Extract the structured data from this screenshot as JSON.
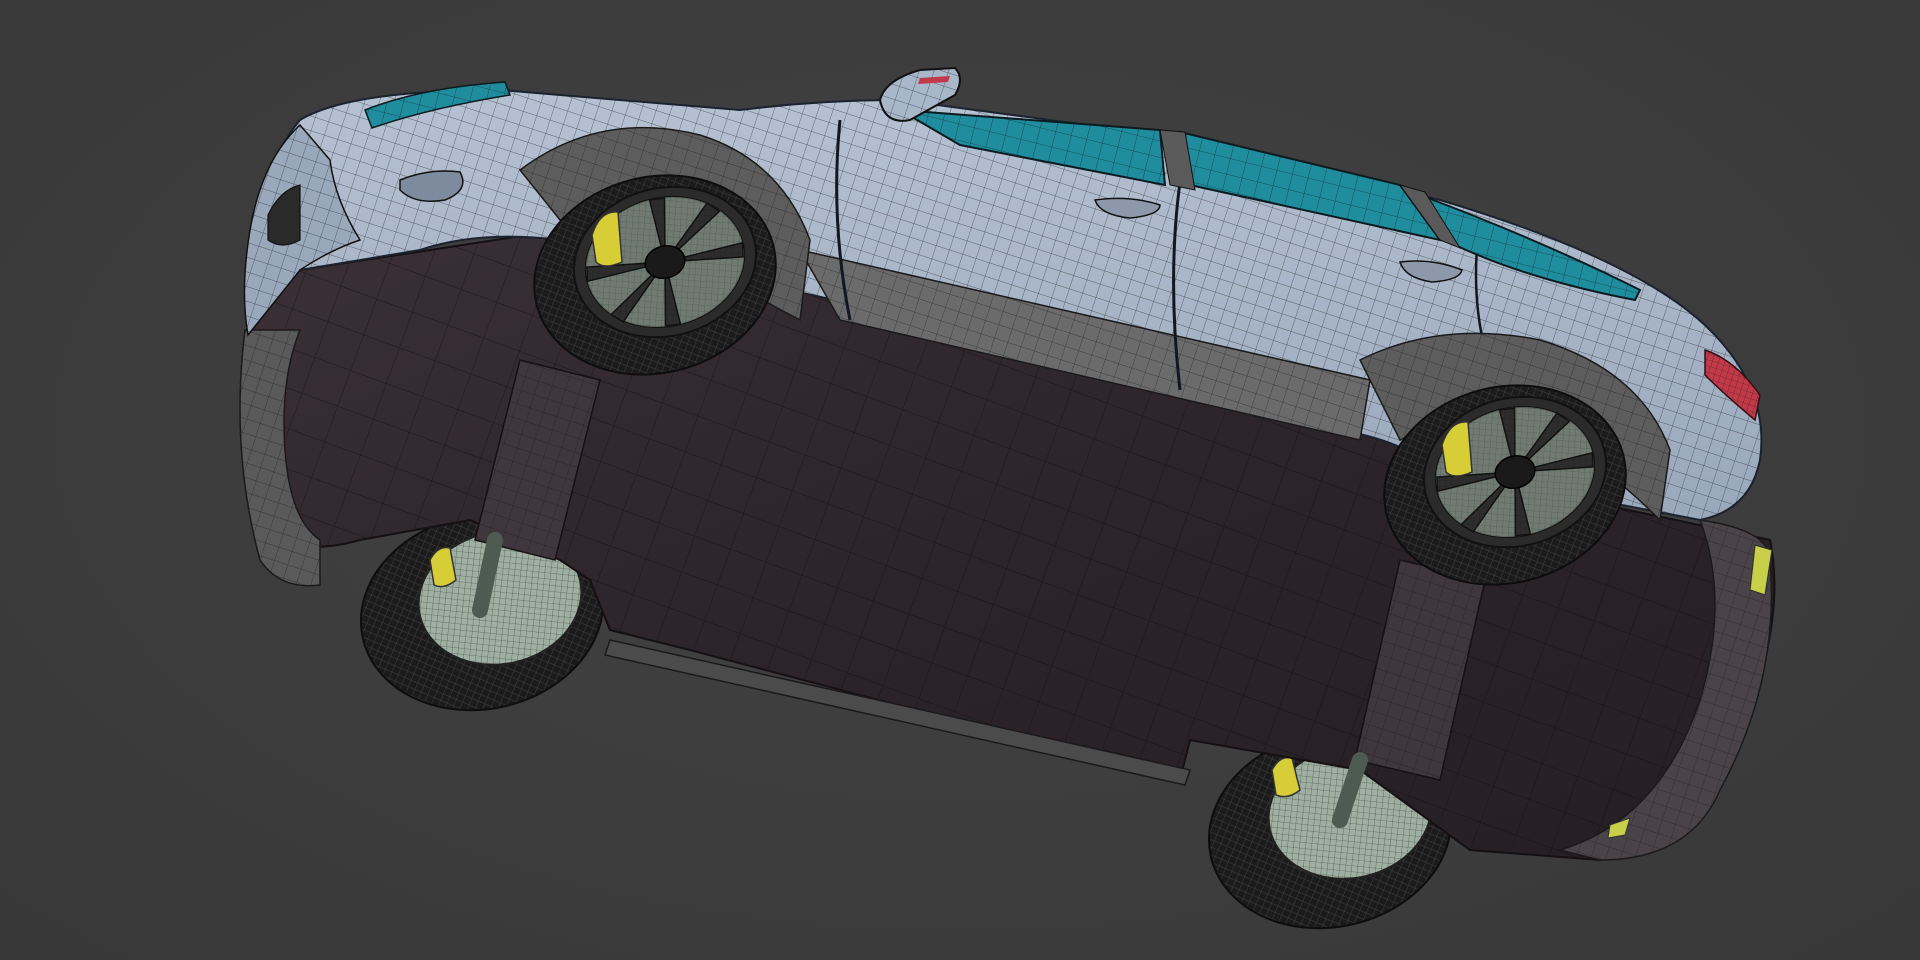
{
  "scene": {
    "subject": "wireframe-car-model-underside-view",
    "background_color": "#3d3d3d",
    "colors": {
      "body_paint": "#a9b7cb",
      "underbody": "#2c2429",
      "trim": "#6b6b6b",
      "glass": "#1f8d9d",
      "tire": "#1c1c1c",
      "rim": "#3a3a3a",
      "inner_wheel_disc": "#9fb0a2",
      "brake_caliper": "#d6cd37",
      "tail_light": "#c23a49",
      "reflector": "#c8d04a",
      "wire": "#1a1a1a"
    }
  }
}
